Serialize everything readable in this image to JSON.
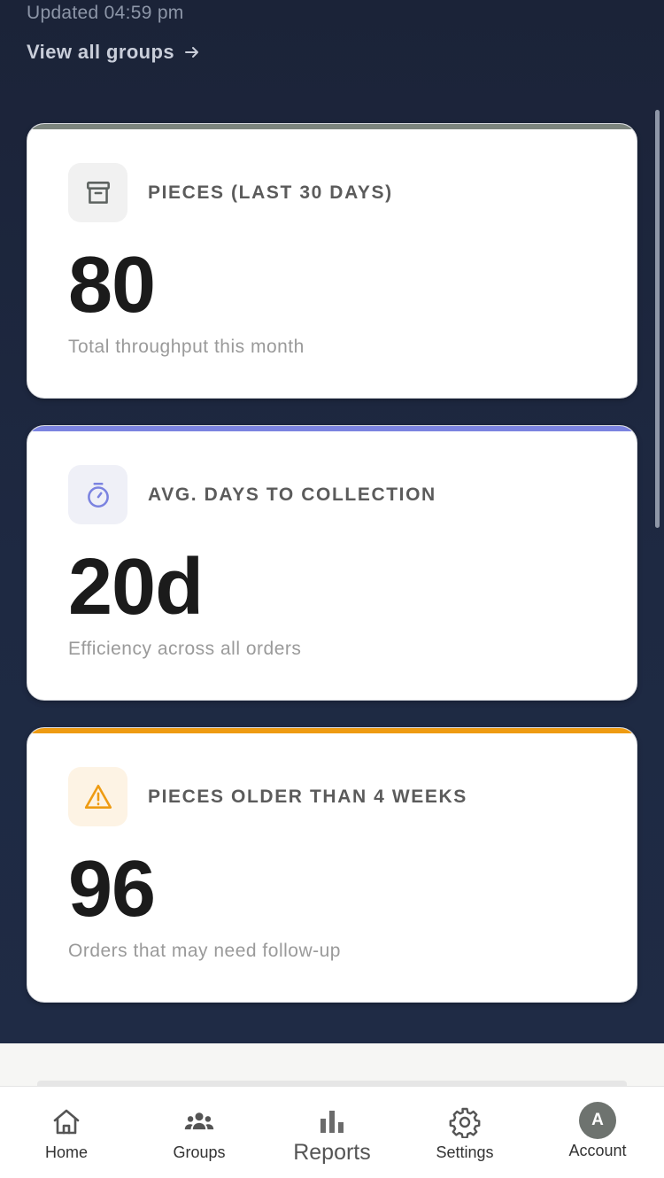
{
  "header": {
    "updated_text": "Updated 04:59 pm",
    "view_all_label": "View all groups"
  },
  "cards": [
    {
      "label": "PIECES (LAST 30 DAYS)",
      "value": "80",
      "description": "Total throughput this month",
      "icon": "archive-box-icon",
      "accent_color": "#7c857e",
      "icon_bg": "#f1f1f1",
      "icon_color": "#5d6360"
    },
    {
      "label": "AVG. DAYS TO COLLECTION",
      "value": "20d",
      "description": "Efficiency across all orders",
      "icon": "stopwatch-icon",
      "accent_color": "#7b83e0",
      "icon_bg": "#eff0f7",
      "icon_color": "#7b83e0"
    },
    {
      "label": "PIECES OLDER THAN 4 WEEKS",
      "value": "96",
      "description": "Orders that may need follow-up",
      "icon": "warning-triangle-icon",
      "accent_color": "#ee9b12",
      "icon_bg": "#fdf3e4",
      "icon_color": "#ee9b12"
    }
  ],
  "nav": {
    "items": [
      {
        "label": "Home",
        "icon": "home-icon"
      },
      {
        "label": "Groups",
        "icon": "groups-icon"
      },
      {
        "label": "Reports",
        "icon": "bar-chart-icon",
        "active": true
      },
      {
        "label": "Settings",
        "icon": "gear-icon"
      },
      {
        "label": "Account",
        "icon": "avatar",
        "avatar_letter": "A"
      }
    ]
  }
}
